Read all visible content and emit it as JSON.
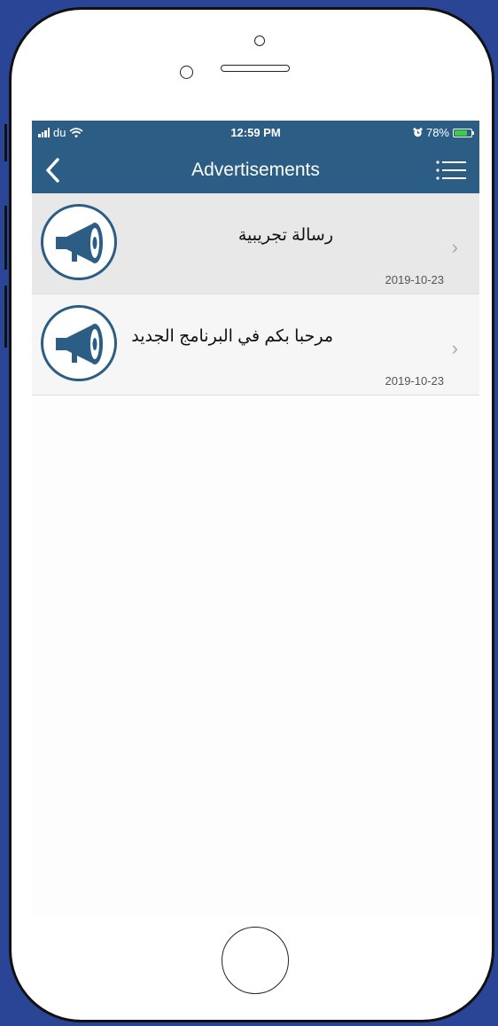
{
  "status_bar": {
    "carrier": "du",
    "time": "12:59 PM",
    "battery": "78%"
  },
  "nav": {
    "title": "Advertisements",
    "back_icon": "chevron-left-icon",
    "menu_icon": "list-menu-icon"
  },
  "advertisements": [
    {
      "title": "رسالة تجريبية",
      "date": "2019-10-23",
      "icon": "megaphone-icon"
    },
    {
      "title": "مرحبا بكم في البرنامج الجديد",
      "date": "2019-10-23",
      "icon": "megaphone-icon"
    }
  ],
  "colors": {
    "background": "#2a4595",
    "nav_bar": "#2b5d85",
    "selected_row": "#e8e8e8"
  }
}
